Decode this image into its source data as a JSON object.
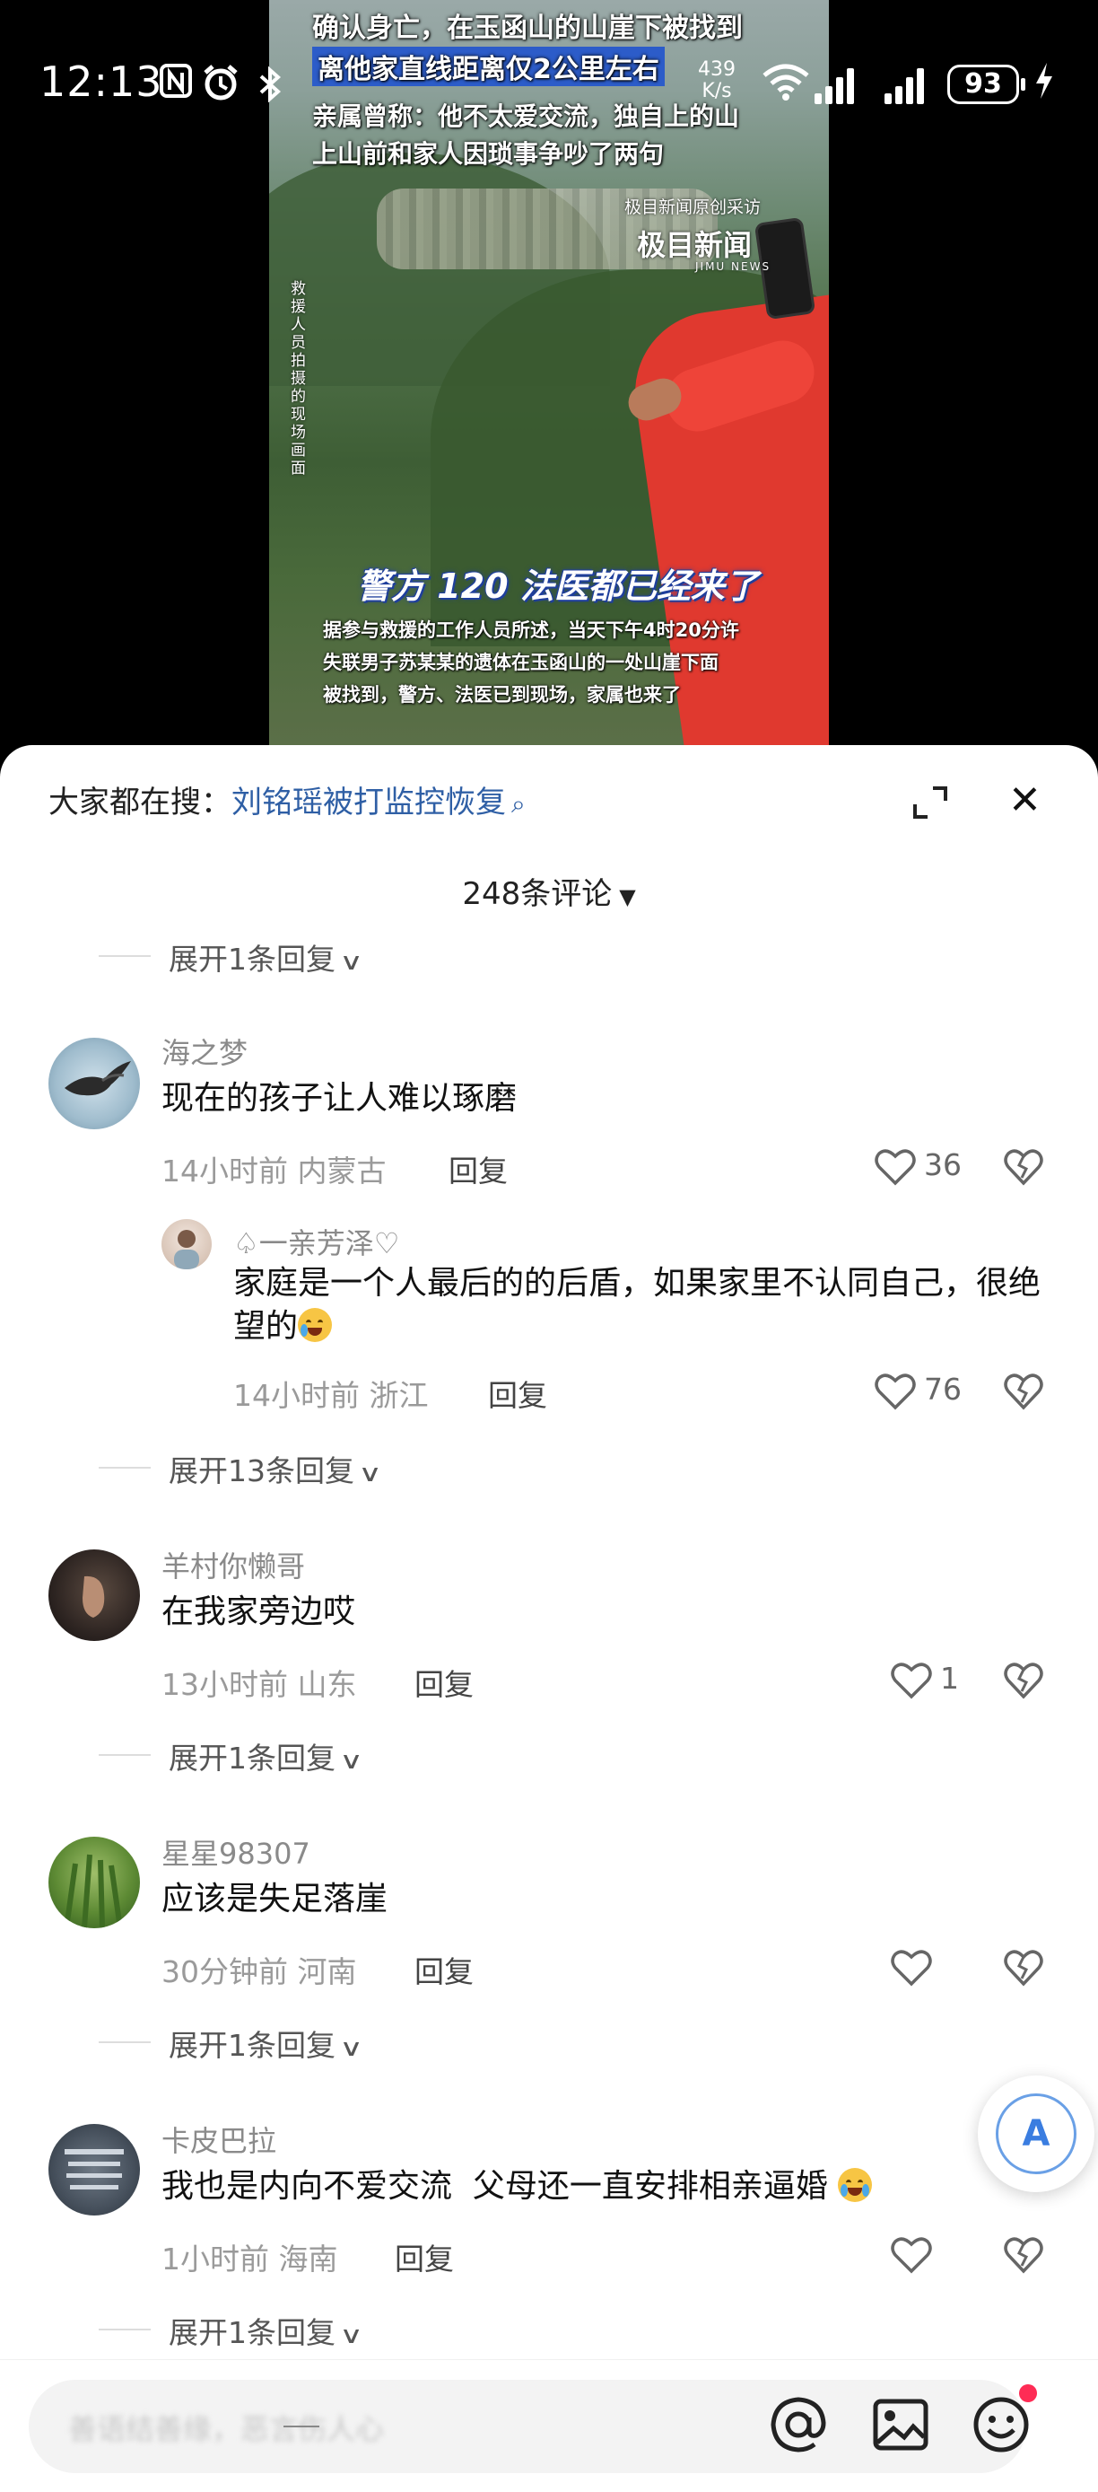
{
  "status_bar": {
    "time": "12:13",
    "net_speed_value": "439",
    "net_speed_unit": "K/s",
    "battery": "93"
  },
  "video": {
    "caption_line1": "确认身亡，在玉函山的山崖下被找到",
    "caption_line2": "离他家直线距离仅2公里左右",
    "caption_line3": "亲属曾称：他不太爱交流，独自上的山",
    "caption_line4": "上山前和家人因琐事争吵了两句",
    "source_small": "极目新闻原创采访",
    "logo_text": "极目新闻",
    "logo_en": "JIMU NEWS",
    "vertical_note": "救援人员拍摄的现场画面",
    "slogan": "警方 120 法医都已经来了",
    "subtitle_line1": "据参与救援的工作人员所述，当天下午4时20分许",
    "subtitle_line2": "失联男子苏某某的遗体在玉函山的一处山崖下面",
    "subtitle_line3": "被找到，警方、法医已到现场，家属也来了"
  },
  "sheet": {
    "search_prefix": "大家都在搜：",
    "search_link": "刘铭瑶被打监控恢复",
    "comment_count": "248条评论",
    "expand_replies": [
      "展开1条回复",
      "展开13条回复",
      "展开1条回复",
      "展开1条回复",
      "展开1条回复"
    ],
    "reply_label": "回复",
    "comments": [
      {
        "user": "海之梦",
        "text": "现在的孩子让人难以琢磨",
        "time": "14小时前",
        "location": "内蒙古",
        "likes": "36"
      },
      {
        "user": "♤一亲芳泽♡",
        "text": "家庭是一个人最后的的后盾，如果家里不认同自己，很绝望的",
        "time": "14小时前",
        "location": "浙江",
        "likes": "76"
      },
      {
        "user": "羊村你懒哥",
        "text": "在我家旁边哎",
        "time": "13小时前",
        "location": "山东",
        "likes": "1"
      },
      {
        "user": "星星98307",
        "text": "应该是失足落崖",
        "time": "30分钟前",
        "location": "河南",
        "likes": ""
      },
      {
        "user": "卡皮巴拉",
        "text": "我也是内向不爱交流  父母还一直安排相亲逼婚",
        "time": "1小时前",
        "location": "海南",
        "likes": ""
      }
    ]
  },
  "translate_label": "A",
  "input": {
    "placeholder": "善语结善缘，恶言伤人心"
  },
  "colors": {
    "link": "#2f5fa5",
    "notification_dot": "#fe2c55",
    "caption_highlight": "#2c5cc9"
  }
}
